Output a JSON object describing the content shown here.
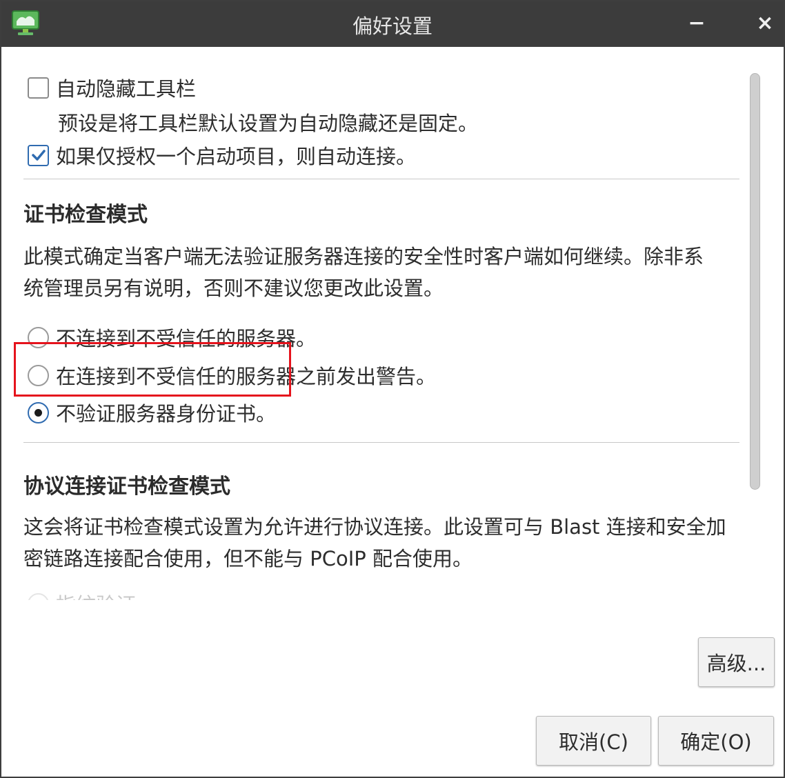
{
  "window": {
    "title": "偏好设置",
    "minimize_label": "−",
    "close_label": "×"
  },
  "general": {
    "auto_hide_toolbar": {
      "label": "自动隐藏工具栏",
      "checked": false
    },
    "auto_hide_description": "预设是将工具栏默认设置为自动隐藏还是固定。",
    "auto_connect": {
      "label": "如果仅授权一个启动项目，则自动连接。",
      "checked": true
    }
  },
  "cert_mode": {
    "title": "证书检查模式",
    "description_line1": "此模式确定当客户端无法验证服务器连接的安全性时客户端如何继续。除非系",
    "description_line2": "统管理员另有说明，否则不建议您更改此设置。",
    "options": [
      {
        "label": "不连接到不受信任的服务器。",
        "selected": false
      },
      {
        "label": "在连接到不受信任的服务器之前发出警告。",
        "selected": false
      },
      {
        "label": "不验证服务器身份证书。",
        "selected": true
      }
    ]
  },
  "protocol_cert_mode": {
    "title": "协议连接证书检查模式",
    "description_line1": "这会将证书检查模式设置为允许进行协议连接。此设置可与 Blast 连接和安全加",
    "description_line2": "密链路连接配合使用，但不能与 PCoIP 配合使用。",
    "partial_option_label": "指纹验证"
  },
  "buttons": {
    "advanced": "高级...",
    "cancel": "取消(C)",
    "ok": "确定(O)"
  },
  "colors": {
    "titlebar": "#3c3c3c",
    "highlight": "#e5131c",
    "accent": "#2f6bb0",
    "app_icon": "#4caf50"
  }
}
